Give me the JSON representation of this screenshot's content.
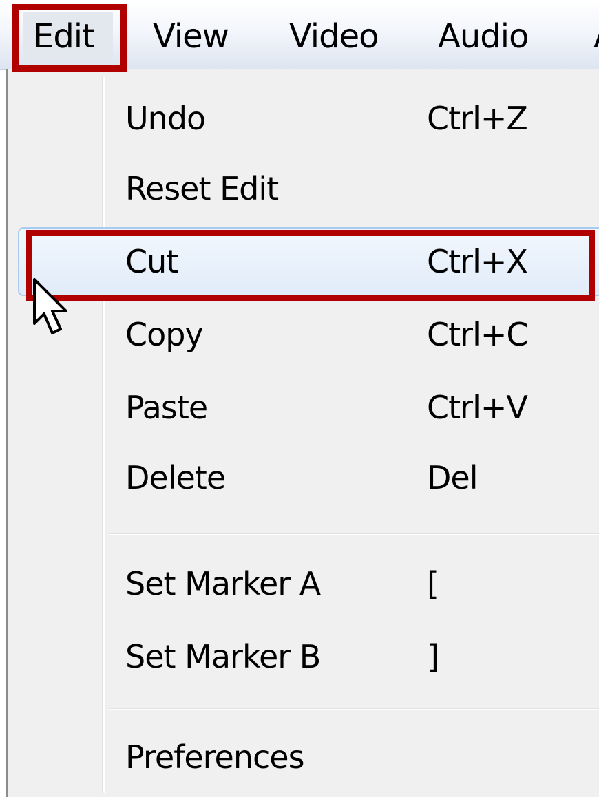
{
  "menubar": {
    "items": [
      {
        "label": "Edit",
        "active": true
      },
      {
        "label": "View"
      },
      {
        "label": "Video"
      },
      {
        "label": "Audio"
      },
      {
        "label": "A"
      }
    ]
  },
  "edit_menu": {
    "items": [
      {
        "label": "Undo",
        "shortcut": "Ctrl+Z"
      },
      {
        "label": "Reset Edit",
        "shortcut": ""
      },
      {
        "label": "Cut",
        "shortcut": "Ctrl+X",
        "hovered": true
      },
      {
        "label": "Copy",
        "shortcut": "Ctrl+C"
      },
      {
        "label": "Paste",
        "shortcut": "Ctrl+V"
      },
      {
        "label": "Delete",
        "shortcut": "Del"
      },
      {
        "label": "Set Marker A",
        "shortcut": "["
      },
      {
        "label": "Set Marker B",
        "shortcut": "]"
      },
      {
        "label": "Preferences",
        "shortcut": ""
      }
    ]
  },
  "annotation_color": "#b00000",
  "hover_border_color": "#a8cbf0",
  "icons": [
    "mouse-pointer-icon"
  ]
}
